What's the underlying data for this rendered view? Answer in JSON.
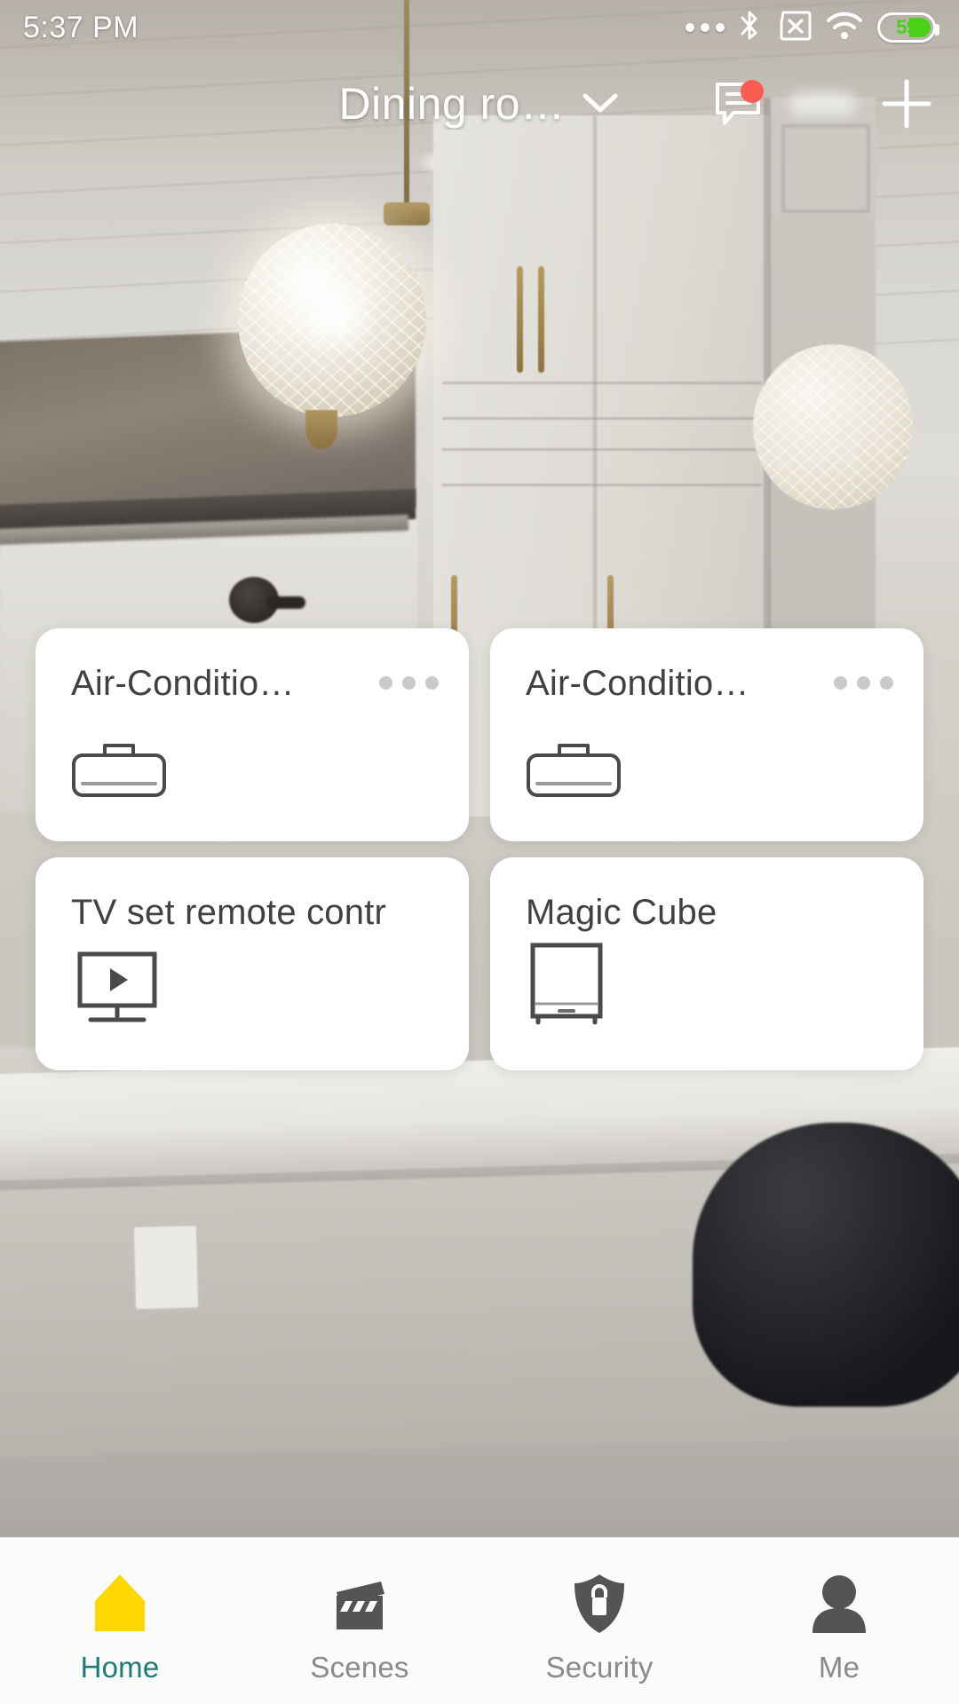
{
  "status_bar": {
    "time": "5:37 PM",
    "icons": [
      "more-dots-icon",
      "bluetooth-icon",
      "no-sim-icon",
      "wifi-icon",
      "battery-icon"
    ],
    "battery_percent": "59",
    "battery_color": "#49d017"
  },
  "header": {
    "room_title": "Dining ro…",
    "dropdown_icon": "chevron-down-icon",
    "message_icon": "message-icon",
    "has_unread_badge": true,
    "badge_color": "#fc5d52",
    "add_icon": "plus-icon"
  },
  "devices": [
    {
      "name": "Air-Conditio…",
      "icon": "air-conditioner-icon",
      "menu_icon": "more-options-icon",
      "has_menu": true
    },
    {
      "name": "Air-Conditio…",
      "icon": "air-conditioner-icon",
      "menu_icon": "more-options-icon",
      "has_menu": true
    },
    {
      "name": "TV set remote contr…",
      "icon": "tv-icon",
      "menu_icon": "more-options-icon",
      "has_menu": false
    },
    {
      "name": "Magic Cube",
      "icon": "magic-cube-icon",
      "menu_icon": "more-options-icon",
      "has_menu": false
    }
  ],
  "bottom_nav": {
    "active_color": "#1c7d73",
    "active_icon_color": "#fcd800",
    "items": [
      {
        "label": "Home",
        "icon": "home-icon",
        "active": true
      },
      {
        "label": "Scenes",
        "icon": "clapperboard-icon",
        "active": false
      },
      {
        "label": "Security",
        "icon": "shield-lock-icon",
        "active": false
      },
      {
        "label": "Me",
        "icon": "person-icon",
        "active": false
      }
    ]
  }
}
